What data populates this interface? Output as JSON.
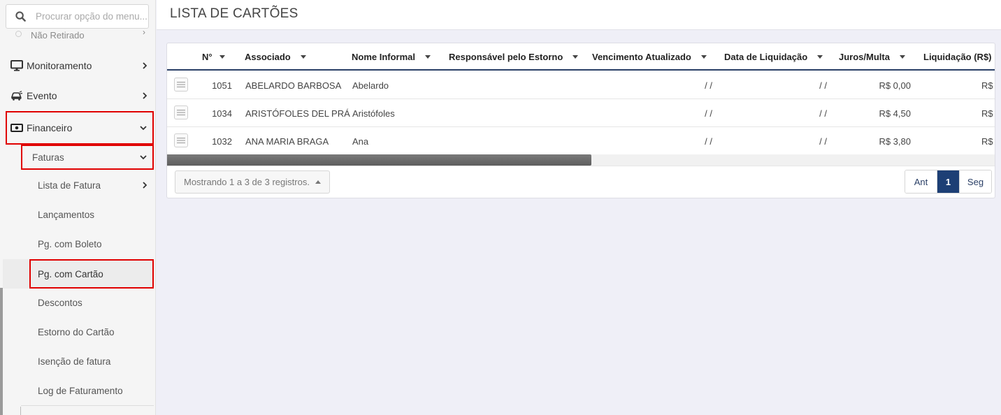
{
  "search": {
    "placeholder": "Procurar opção do menu..."
  },
  "sidebar": {
    "partial_item": "Não Retirado",
    "items": [
      {
        "label": "Monitoramento",
        "icon": "monitor-icon"
      },
      {
        "label": "Evento",
        "icon": "car-icon"
      },
      {
        "label": "Financeiro",
        "icon": "money-icon"
      }
    ],
    "faturas_label": "Faturas",
    "sub_items": [
      {
        "label": "Lista de Fatura"
      },
      {
        "label": "Lançamentos"
      },
      {
        "label": "Pg. com Boleto"
      },
      {
        "label": "Pg. com Cartão"
      },
      {
        "label": "Descontos"
      },
      {
        "label": "Estorno do Cartão"
      },
      {
        "label": "Isenção de fatura"
      },
      {
        "label": "Log de Faturamento"
      }
    ],
    "highlight_color": "#e00000"
  },
  "page": {
    "title": "LISTA DE CARTÕES"
  },
  "table": {
    "columns": [
      "N°",
      "Associado",
      "Nome Informal",
      "Responsável pelo Estorno",
      "Vencimento Atualizado",
      "Data de Liquidação",
      "Juros/Multa",
      "Liquidação (R$)"
    ],
    "rows": [
      {
        "num": "1051",
        "associado": "ABELARDO BARBOSA",
        "nome_informal": "Abelardo",
        "responsavel": "",
        "vencimento": "/ /",
        "liquidacao": "/ /",
        "juros": "R$ 0,00",
        "valor": "R$ ("
      },
      {
        "num": "1034",
        "associado": "ARISTÓFOLES DEL PRÁ",
        "nome_informal": "Aristófoles",
        "responsavel": "",
        "vencimento": "/ /",
        "liquidacao": "/ /",
        "juros": "R$ 4,50",
        "valor": "R$ ("
      },
      {
        "num": "1032",
        "associado": "ANA MARIA BRAGA",
        "nome_informal": "Ana",
        "responsavel": "",
        "vencimento": "/ /",
        "liquidacao": "/ /",
        "juros": "R$ 3,80",
        "valor": "R$ ("
      }
    ],
    "records_info": "Mostrando 1 a 3 de 3 registros.",
    "header_rule_color": "#2a3f66"
  },
  "pagination": {
    "prev": "Ant",
    "current": "1",
    "next": "Seg",
    "active_color": "#1d3f75"
  }
}
